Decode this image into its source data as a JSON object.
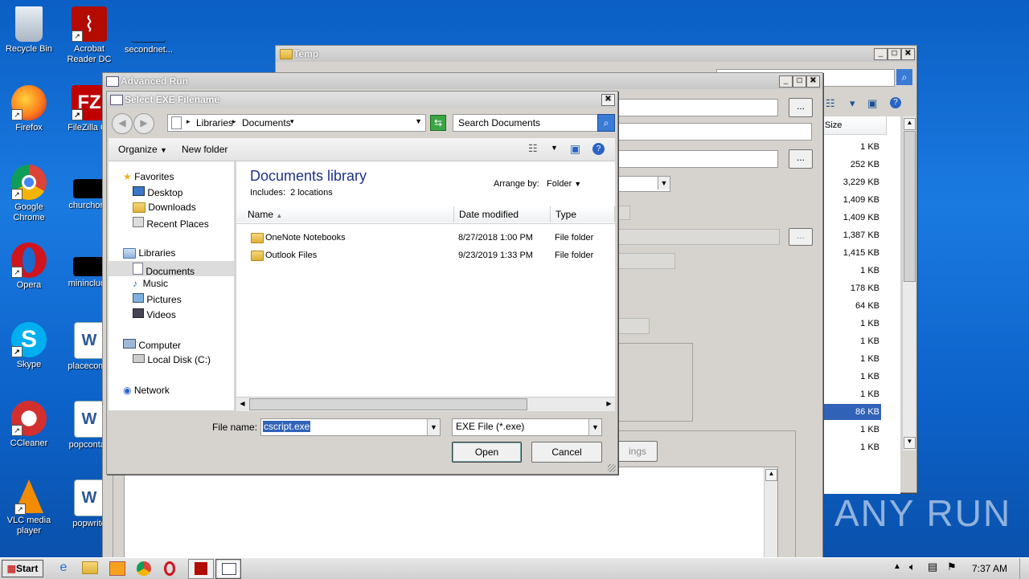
{
  "desktop": {
    "icons": [
      {
        "label": "Recycle Bin",
        "icon": "recycle-bin-icon"
      },
      {
        "label": "Acrobat Reader DC",
        "icon": "acrobat-icon"
      },
      {
        "label": "secondnet...",
        "icon": "file-icon"
      },
      {
        "label": "Firefox",
        "icon": "firefox-icon"
      },
      {
        "label": "FileZilla Cli",
        "icon": "filezilla-icon"
      },
      {
        "label": "Google Chrome",
        "icon": "chrome-icon"
      },
      {
        "label": "churchone",
        "icon": "file-icon"
      },
      {
        "label": "Opera",
        "icon": "opera-icon"
      },
      {
        "label": "mininclude",
        "icon": "file-icon"
      },
      {
        "label": "Skype",
        "icon": "skype-icon"
      },
      {
        "label": "placecomp",
        "icon": "word-icon"
      },
      {
        "label": "CCleaner",
        "icon": "ccleaner-icon"
      },
      {
        "label": "popcontac",
        "icon": "word-icon"
      },
      {
        "label": "VLC media player",
        "icon": "vlc-icon"
      },
      {
        "label": "popwrite",
        "icon": "word-icon"
      }
    ]
  },
  "temp_window": {
    "title": "Temp",
    "size_header": "Size",
    "sizes": [
      "1 KB",
      "252 KB",
      "3,229 KB",
      "1,409 KB",
      "1,409 KB",
      "1,387 KB",
      "1,415 KB",
      "1 KB",
      "178 KB",
      "64 KB",
      "1 KB",
      "1 KB",
      "1 KB",
      "1 KB",
      "1 KB",
      "86 KB",
      "1 KB",
      "1 KB"
    ],
    "selected_index": 15
  },
  "advanced_run": {
    "title": "Advanced Run",
    "browse_label": "...",
    "settings_label": "ings"
  },
  "dialog": {
    "title": "Select EXE Filename",
    "breadcrumb": [
      "Libraries",
      "Documents"
    ],
    "search_placeholder": "Search Documents",
    "organize_label": "Organize",
    "new_folder_label": "New folder",
    "nav": {
      "favorites": "Favorites",
      "favorites_items": [
        "Desktop",
        "Downloads",
        "Recent Places"
      ],
      "libraries": "Libraries",
      "libraries_items": [
        "Documents",
        "Music",
        "Pictures",
        "Videos"
      ],
      "computer": "Computer",
      "computer_items": [
        "Local Disk (C:)"
      ],
      "network": "Network"
    },
    "library_title": "Documents library",
    "library_includes": "Includes:",
    "library_locations": "2 locations",
    "arrange_by_label": "Arrange by:",
    "arrange_by_value": "Folder",
    "columns": [
      "Name",
      "Date modified",
      "Type"
    ],
    "rows": [
      {
        "name": "OneNote Notebooks",
        "date": "8/27/2018 1:00 PM",
        "type": "File folder"
      },
      {
        "name": "Outlook Files",
        "date": "9/23/2019 1:33 PM",
        "type": "File folder"
      }
    ],
    "file_name_label": "File name:",
    "file_name_value": "cscript.exe",
    "file_type_value": "EXE File (*.exe)",
    "open_label": "Open",
    "cancel_label": "Cancel"
  },
  "taskbar": {
    "start_label": "Start",
    "time": "7:37 AM",
    "pinned": [
      "ie-icon",
      "explorer-icon",
      "media-player-icon",
      "chrome-icon",
      "opera-icon",
      "acrobat-icon",
      "advanced-run-icon"
    ]
  },
  "watermark": "ANY RUN"
}
